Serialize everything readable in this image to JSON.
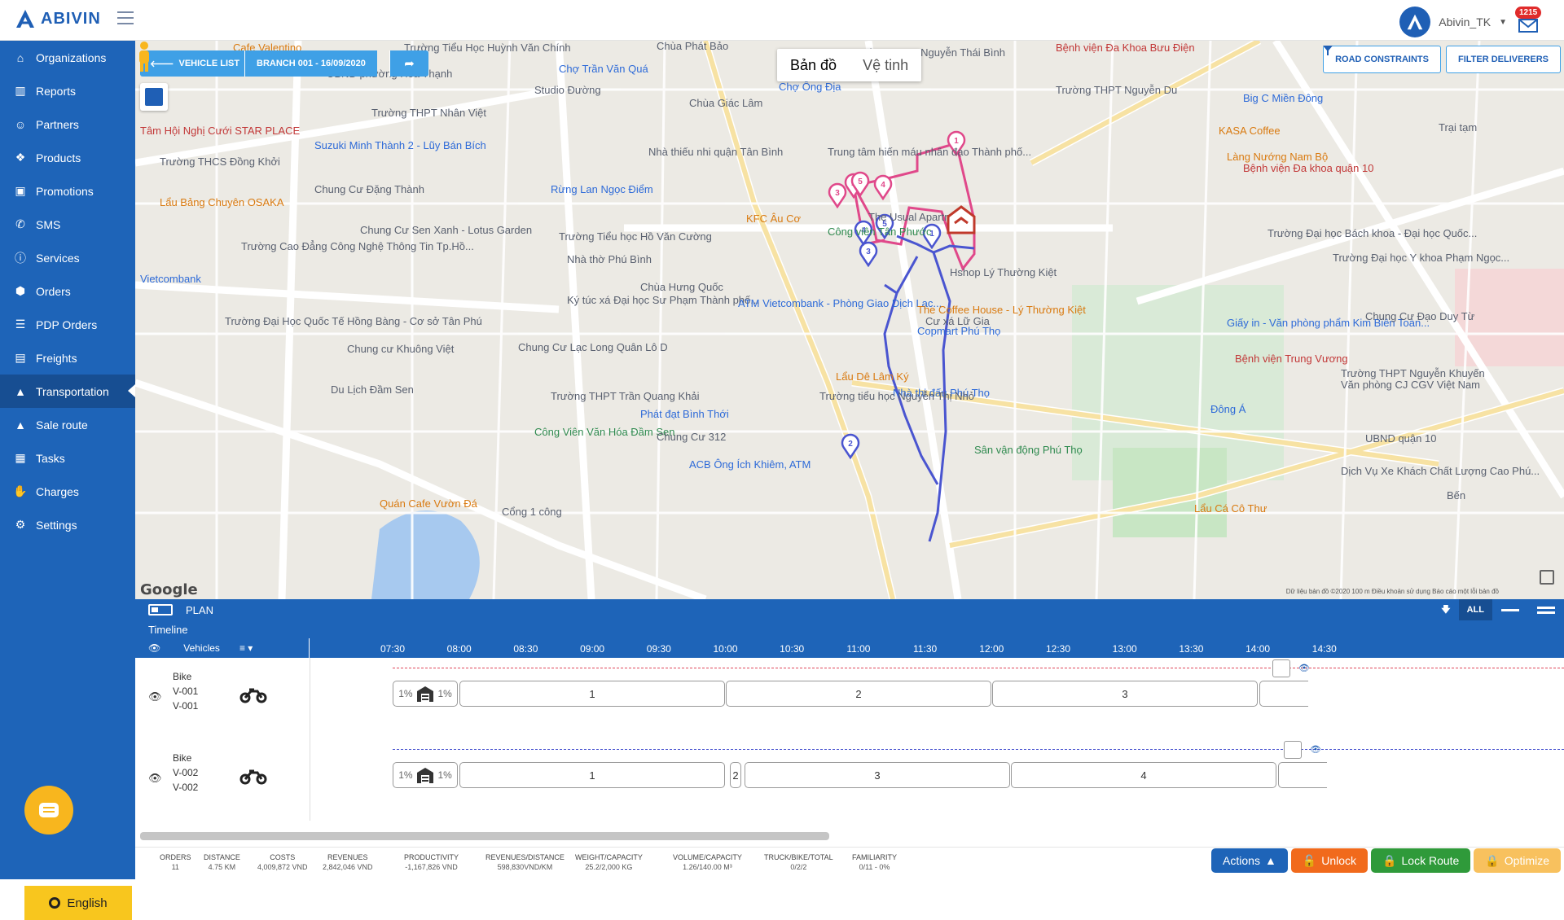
{
  "app": {
    "brand": "ABIVIN",
    "user": "Abivin_TK",
    "notifications": "1215"
  },
  "sidebar": {
    "items": [
      {
        "label": "Organizations",
        "icon": "home-icon"
      },
      {
        "label": "Reports",
        "icon": "bar-chart-icon"
      },
      {
        "label": "Partners",
        "icon": "users-icon"
      },
      {
        "label": "Products",
        "icon": "boxes-icon"
      },
      {
        "label": "Promotions",
        "icon": "gift-icon"
      },
      {
        "label": "SMS",
        "icon": "phone-icon"
      },
      {
        "label": "Services",
        "icon": "info-icon"
      },
      {
        "label": "Orders",
        "icon": "cubes-icon"
      },
      {
        "label": "PDP Orders",
        "icon": "list-icon"
      },
      {
        "label": "Freights",
        "icon": "freight-icon"
      },
      {
        "label": "Transportation",
        "icon": "road-icon"
      },
      {
        "label": "Sale route",
        "icon": "road-icon"
      },
      {
        "label": "Tasks",
        "icon": "calendar-icon"
      },
      {
        "label": "Charges",
        "icon": "hand-coin-icon"
      },
      {
        "label": "Settings",
        "icon": "gear-icon"
      }
    ],
    "active": "Transportation",
    "language": "English"
  },
  "map": {
    "vehicle_list_label": "VEHICLE LIST",
    "branch_label": "BRANCH 001 - 16/09/2020",
    "map_type_options": [
      "Bản đồ",
      "Vệ tinh"
    ],
    "map_type_selected": "Bản đồ",
    "road_constraints_label": "ROAD CONSTRAINTS",
    "filter_deliverers_label": "FILTER DELIVERERS",
    "google_label": "Google",
    "credit": "Dữ liệu bản đồ ©2020   100 m        Điều khoản sử dụng   Báo cáo một lỗi bản đồ",
    "places": [
      "Cafe Valentino",
      "Trường Tiểu Học Huỳnh Văn Chính",
      "Chùa Phát Bảo",
      "Trường THPT Nguyễn Thái Bình",
      "Bệnh viện Đa Khoa Bưu Điện",
      "UBND phường Hòa Thạnh",
      "Chợ Trần Văn Quá",
      "Studio Đường",
      "Chợ Ông Địa",
      "Trường THPT Nguyễn Du",
      "Big C Miền Đông",
      "Trường THPT Nhân Việt",
      "Chùa Giác Lâm",
      "Tâm Hội Nghị Cưới STAR PLACE",
      "KASA Coffee",
      "Suzuki Minh Thành 2 - Lũy Bán Bích",
      "Trường THCS Đồng Khởi",
      "Nhà thiếu nhi quận Tân Bình",
      "Trung tâm hiến máu nhân đạo Thành phố...",
      "Làng Nướng Nam Bộ",
      "Bệnh viện Đa khoa quận 10",
      "Chung Cư Đặng Thành",
      "Rừng Lan Ngọc Điểm",
      "Lẩu Bảng Chuyên OSAKA",
      "The Usual Apartment",
      "Chung Cư Sen Xanh - Lotus Garden",
      "KFC Âu Cơ",
      "Trường Tiểu học Hồ Văn Cường",
      "Công viên Tân Phước",
      "Trường Cao Đẳng Công Nghệ Thông Tin Tp.Hồ...",
      "Trường Đại học Bách khoa - Đại học Quốc...",
      "Vietcombank",
      "Nhà thờ Phú Bình",
      "Hshop Lý Thường Kiệt",
      "Trường Đại học Y khoa Phạm Ngọc...",
      "Chùa Hưng Quốc",
      "Ký túc xá Đại học Sư Phạm Thành phố...",
      "ATM Vietcombank - Phòng Giao Dịch Lạc...",
      "The Coffee House - Lý Thường Kiệt",
      "Giấy in - Văn phòng phẩm Kim Biên Toàn...",
      "Chung Cư Đạo Duy Từ",
      "Trường Đại Học Quốc Tế Hồng Bàng - Cơ sở Tân Phú",
      "Cư xá Lữ Gia",
      "Copmart Phú Thọ",
      "Chung cư Khuông Việt",
      "Chung Cư Lạc Long Quân Lô D",
      "Bệnh viện Trung Vương",
      "Lẩu Dê Lâm Ký",
      "Du Lịch Đầm Sen",
      "Trường THPT Trần Quang Khải",
      "Nhà thi đấu Phú Thọ",
      "Trường tiểu học Nguyễn Thị Nhỏ",
      "Đông Á",
      "Văn phòng CJ CGV Việt Nam",
      "Trường THPT Nguyễn Khuyến",
      "Phát đạt Bình Thới",
      "Công Viên Văn Hóa Đầm Sen",
      "Chung Cư 312",
      "ACB Ông Ích Khiêm, ATM",
      "Sân vận động Phú Thọ",
      "UBND quận 10",
      "Dịch Vụ Xe Khách Chất Lượng Cao Phú...",
      "Quán Cafe Vườn Đá",
      "Cổng 1 công",
      "Lẩu Cá Cô Thư",
      "Trại tạm",
      "Bến"
    ],
    "route_stops_pink": [
      "1",
      "2",
      "3",
      "4",
      "5"
    ],
    "route_stops_blue": [
      "1",
      "2",
      "3",
      "4",
      "5"
    ],
    "colors": {
      "route_pink": "#e0488a",
      "route_blue": "#4a55d0",
      "depot": "#c0392b"
    }
  },
  "plan": {
    "title": "PLAN",
    "all_label": "ALL",
    "timeline_label": "Timeline",
    "vehicles_label": "Vehicles",
    "times": [
      "07:30",
      "08:00",
      "08:30",
      "09:00",
      "09:30",
      "10:00",
      "10:30",
      "11:00",
      "11:30",
      "12:00",
      "12:30",
      "13:00",
      "13:30",
      "14:00",
      "14:30"
    ],
    "vehicles": [
      {
        "type": "Bike",
        "id": "V-001",
        "name": "V-001",
        "load_start": "1%",
        "load_end": "1%",
        "trips": [
          "1",
          "2",
          "3"
        ],
        "color": "#e0485a"
      },
      {
        "type": "Bike",
        "id": "V-002",
        "name": "V-002",
        "load_start": "1%",
        "load_end": "1%",
        "trips": [
          "1",
          "2",
          "3",
          "4"
        ],
        "color": "#4a55d0"
      }
    ]
  },
  "stats": {
    "items": [
      {
        "label": "ORDERS",
        "value": "11"
      },
      {
        "label": "DISTANCE",
        "value": "4.75 KM"
      },
      {
        "label": "COSTS",
        "value": "4,009,872 VND"
      },
      {
        "label": "REVENUES",
        "value": "2,842,046 VND"
      },
      {
        "label": "PRODUCTIVITY",
        "value": "-1,167,826 VND"
      },
      {
        "label": "REVENUES/DISTANCE",
        "value": "598,830VND/KM"
      },
      {
        "label": "WEIGHT/CAPACITY",
        "value": "25.2/2,000 KG"
      },
      {
        "label": "VOLUME/CAPACITY",
        "value": "1.26/140.00 M³"
      },
      {
        "label": "TRUCK/BIKE/TOTAL",
        "value": "0/2/2"
      },
      {
        "label": "FAMILIARITY",
        "value": "0/11 - 0%"
      }
    ]
  },
  "actions": {
    "actions_label": "Actions",
    "unlock_label": "Unlock",
    "lock_label": "Lock Route",
    "optimize_label": "Optimize"
  }
}
